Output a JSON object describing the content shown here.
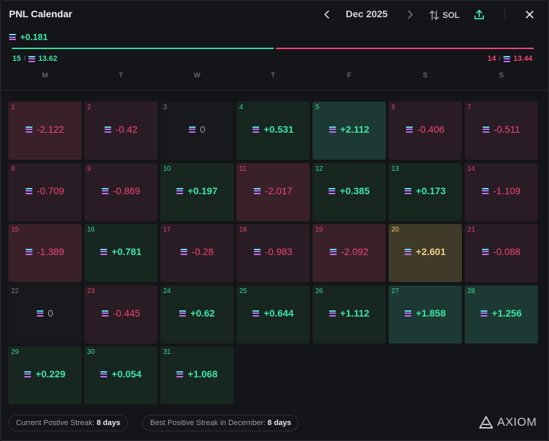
{
  "header": {
    "title": "PNL Calendar",
    "month": "Dec 2025",
    "currency": "SOL"
  },
  "summary": {
    "total": "+0.181",
    "wins": "15",
    "win_amount": "13.62",
    "losses": "14",
    "loss_amount": "13.44"
  },
  "weekdays": [
    "M",
    "T",
    "W",
    "T",
    "F",
    "S",
    "S"
  ],
  "days": [
    {
      "day": "1",
      "value": "-2.122",
      "tone": "neg-strong"
    },
    {
      "day": "2",
      "value": "-0.42",
      "tone": "neg"
    },
    {
      "day": "3",
      "value": "0",
      "tone": "zero"
    },
    {
      "day": "4",
      "value": "+0.531",
      "tone": "pos"
    },
    {
      "day": "5",
      "value": "+2.112",
      "tone": "pos-strong"
    },
    {
      "day": "6",
      "value": "-0.406",
      "tone": "neg"
    },
    {
      "day": "7",
      "value": "-0.511",
      "tone": "neg"
    },
    {
      "day": "8",
      "value": "-0.709",
      "tone": "neg"
    },
    {
      "day": "9",
      "value": "-0.869",
      "tone": "neg"
    },
    {
      "day": "10",
      "value": "+0.197",
      "tone": "pos"
    },
    {
      "day": "11",
      "value": "-2.017",
      "tone": "neg-strong"
    },
    {
      "day": "12",
      "value": "+0.385",
      "tone": "pos"
    },
    {
      "day": "13",
      "value": "+0.173",
      "tone": "pos"
    },
    {
      "day": "14",
      "value": "-1.109",
      "tone": "neg"
    },
    {
      "day": "15",
      "value": "-1.389",
      "tone": "neg-strong"
    },
    {
      "day": "16",
      "value": "+0.781",
      "tone": "pos"
    },
    {
      "day": "17",
      "value": "-0.28",
      "tone": "neg"
    },
    {
      "day": "18",
      "value": "-0.983",
      "tone": "neg"
    },
    {
      "day": "19",
      "value": "-2.092",
      "tone": "neg-strong"
    },
    {
      "day": "20",
      "value": "+2.601",
      "tone": "best"
    },
    {
      "day": "21",
      "value": "-0.088",
      "tone": "neg"
    },
    {
      "day": "22",
      "value": "0",
      "tone": "zero"
    },
    {
      "day": "23",
      "value": "-0.445",
      "tone": "neg"
    },
    {
      "day": "24",
      "value": "+0.62",
      "tone": "pos"
    },
    {
      "day": "25",
      "value": "+0.644",
      "tone": "pos"
    },
    {
      "day": "26",
      "value": "+1.112",
      "tone": "pos"
    },
    {
      "day": "27",
      "value": "+1.858",
      "tone": "pos-strong"
    },
    {
      "day": "28",
      "value": "+1.256",
      "tone": "pos-strong"
    },
    {
      "day": "29",
      "value": "+0.229",
      "tone": "pos"
    },
    {
      "day": "30",
      "value": "+0.054",
      "tone": "pos"
    },
    {
      "day": "31",
      "value": "+1.068",
      "tone": "pos"
    }
  ],
  "footer": {
    "current_streak_label": "Current Postive Streak:",
    "current_streak_value": "8 days",
    "best_streak_label": "Best Positive Streak in December:",
    "best_streak_value": "8 days",
    "brand": "AXIOM"
  },
  "colors": {
    "positive": "#3ee6a8",
    "negative": "#f0457a",
    "best": "#f2d28a"
  }
}
